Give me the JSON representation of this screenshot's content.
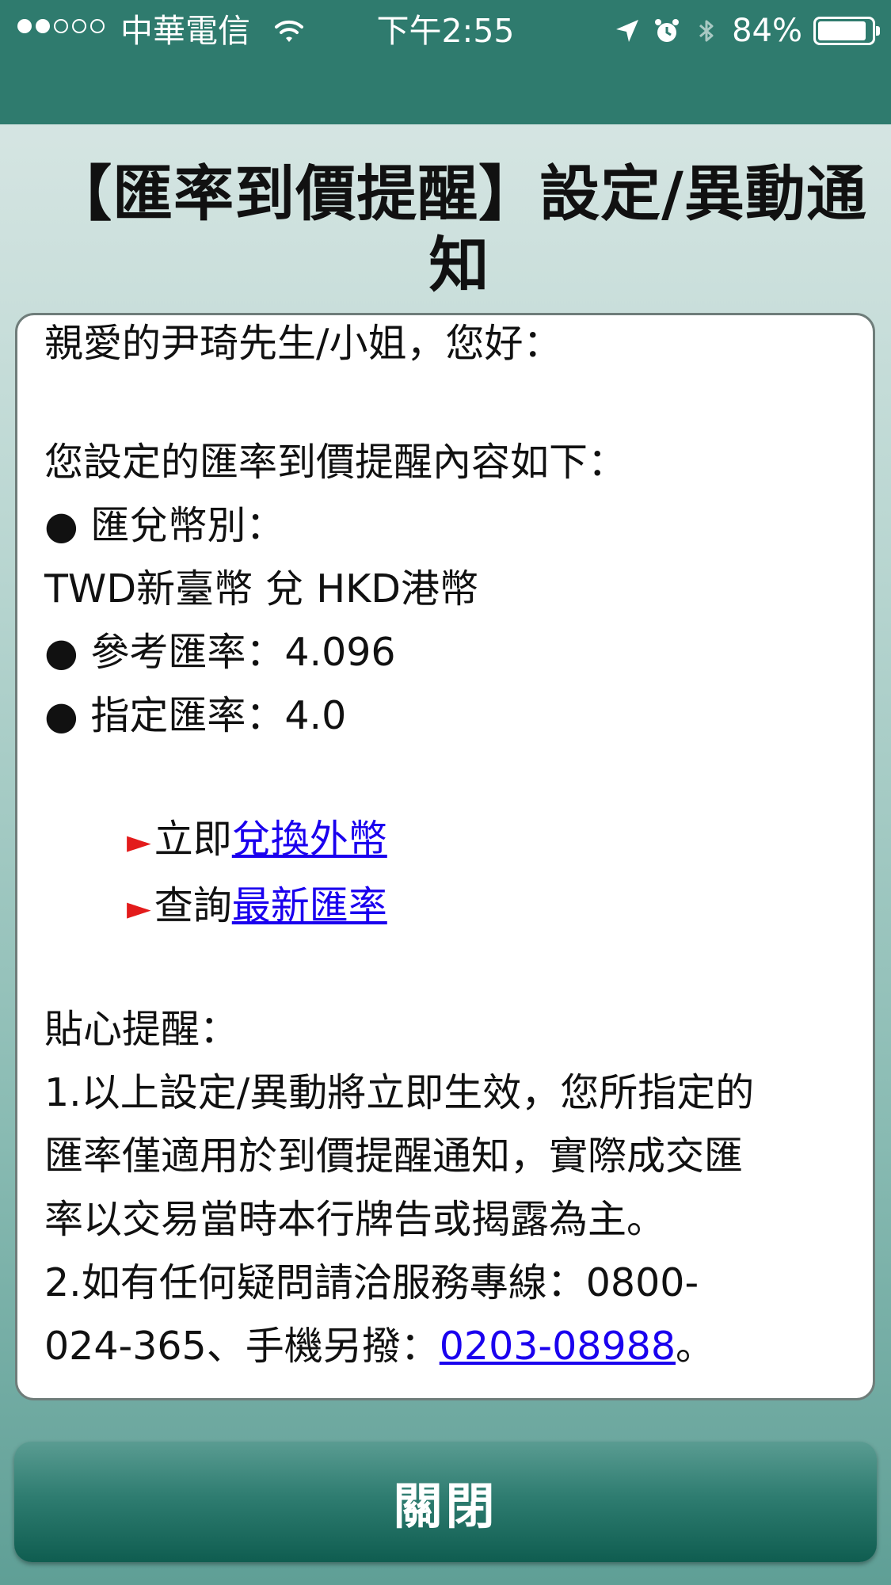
{
  "status_bar": {
    "carrier": "中華電信",
    "time": "下午2:55",
    "battery_percent": "84%",
    "battery_level": 0.84
  },
  "page": {
    "title": "【匯率到價提醒】設定/異動通知"
  },
  "message": {
    "greeting": "親愛的尹琦先生/小姐，您好：",
    "intro": "您設定的匯率到價提醒內容如下：",
    "currency_label": "● 匯兌幣別：",
    "currency_value": "TWD新臺幣 兌 HKD港幣",
    "reference_rate": "● 參考匯率：4.096",
    "target_rate": "● 指定匯率：4.0",
    "links": [
      {
        "prefix": "立即",
        "link_text": "兌換外幣"
      },
      {
        "prefix": "查詢",
        "link_text": "最新匯率"
      }
    ],
    "tips_heading": "貼心提醒：",
    "tip1_line1": "1.以上設定/異動將立即生效，您所指定的",
    "tip1_line2": "匯率僅適用於到價提醒通知，實際成交匯",
    "tip1_line3": "率以交易當時本行牌告或揭露為主。",
    "tip2_line1": "2.如有任何疑問請洽服務專線：0800-",
    "tip2_line2_prefix": "024-365、手機另撥：",
    "tip2_phone": "0203-08988",
    "tip2_suffix": "。"
  },
  "footer": {
    "close_label": "關閉"
  },
  "colors": {
    "header": "#2f7b6e",
    "link": "#1a00ee",
    "arrow": "#e31b1b"
  },
  "icons": [
    "signal-dots-icon",
    "wifi-icon",
    "location-arrow-icon",
    "alarm-clock-icon",
    "bluetooth-icon",
    "battery-icon",
    "arrow-right-icon"
  ]
}
